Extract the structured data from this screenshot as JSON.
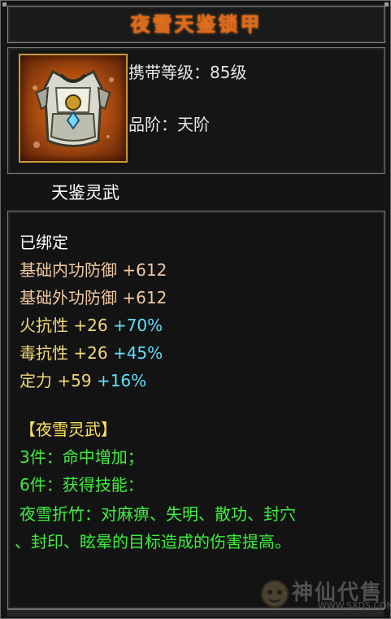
{
  "item": {
    "name": "夜雪天鉴锁甲",
    "level_req": "携带等级：85级",
    "grade": "品阶：天阶",
    "caption": "天鉴灵武",
    "icon": "armor-vest-icon"
  },
  "status": "已绑定",
  "stats": [
    {
      "label": "基础内功防御",
      "value": "+612"
    },
    {
      "label": "基础外功防御",
      "value": "+612"
    },
    {
      "label": "火抗性",
      "value": "+26",
      "pct": "+70%"
    },
    {
      "label": "毒抗性",
      "value": "+26",
      "pct": "+45%"
    },
    {
      "label": "定力",
      "value": "+59",
      "pct": "+16%"
    }
  ],
  "set": {
    "name": "【夜雪灵武】",
    "bonus3": "3件：命中增加；",
    "bonus6": "6件：获得技能：",
    "skill_line1": "夜雪折竹：对麻痹、失明、散功、封穴",
    "skill_line2": "、封印、眩晕的目标造成的伤害提高。"
  },
  "watermark": {
    "text": "神仙代售",
    "url": "WWW.SXDS.COM"
  },
  "colors": {
    "title": "#e06a1a",
    "stat_label": "#f2c9a0",
    "resist_label": "#f0d878",
    "percent": "#5fe0ff",
    "set_name": "#ffe35a",
    "set_text": "#3cf03c"
  }
}
